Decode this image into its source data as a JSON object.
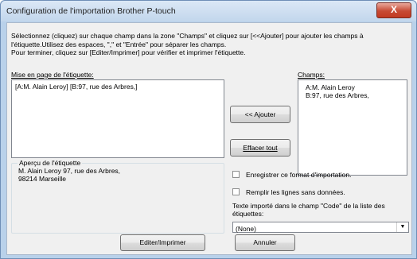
{
  "window": {
    "title": "Configuration de l'importation Brother P-touch",
    "close_glyph": "X"
  },
  "instructions": "Sélectionnez (cliquez) sur chaque champ dans la zone \"Champs\" et cliquez sur [<<Ajouter] pour ajouter les champs à l'étiquette.Utilisez des espaces, \",\" et \"Entrée\" pour séparer les champs.\nPour terminer, cliquez sur [Editer/Imprimer] pour vérifier et imprimer l'étiquette.",
  "layout_section": {
    "label": "Mise en page de l'étiquette:",
    "content": "[A:M. Alain Leroy] [B:97, rue des Arbres,]"
  },
  "fields_section": {
    "label": "Champs:",
    "items": [
      "A:M. Alain Leroy",
      "B:97, rue des Arbres,"
    ]
  },
  "buttons": {
    "add": "<< Ajouter",
    "clear_all": "Effacer tout",
    "edit_print": "Editer/Imprimer",
    "cancel": "Annuler"
  },
  "preview": {
    "title": "Aperçu de l'étiquette",
    "text": "M. Alain Leroy 97, rue des Arbres,\n98214 Marseille"
  },
  "options": {
    "save_format": {
      "label": "Enregistrer ce format d'importation.",
      "checked": false
    },
    "fill_empty": {
      "label": "Remplir les lignes sans données.",
      "checked": false
    },
    "code_field_label": "Texte importé dans le champ \"Code\" de la liste des étiquettes:",
    "code_field_value": "(None)"
  }
}
